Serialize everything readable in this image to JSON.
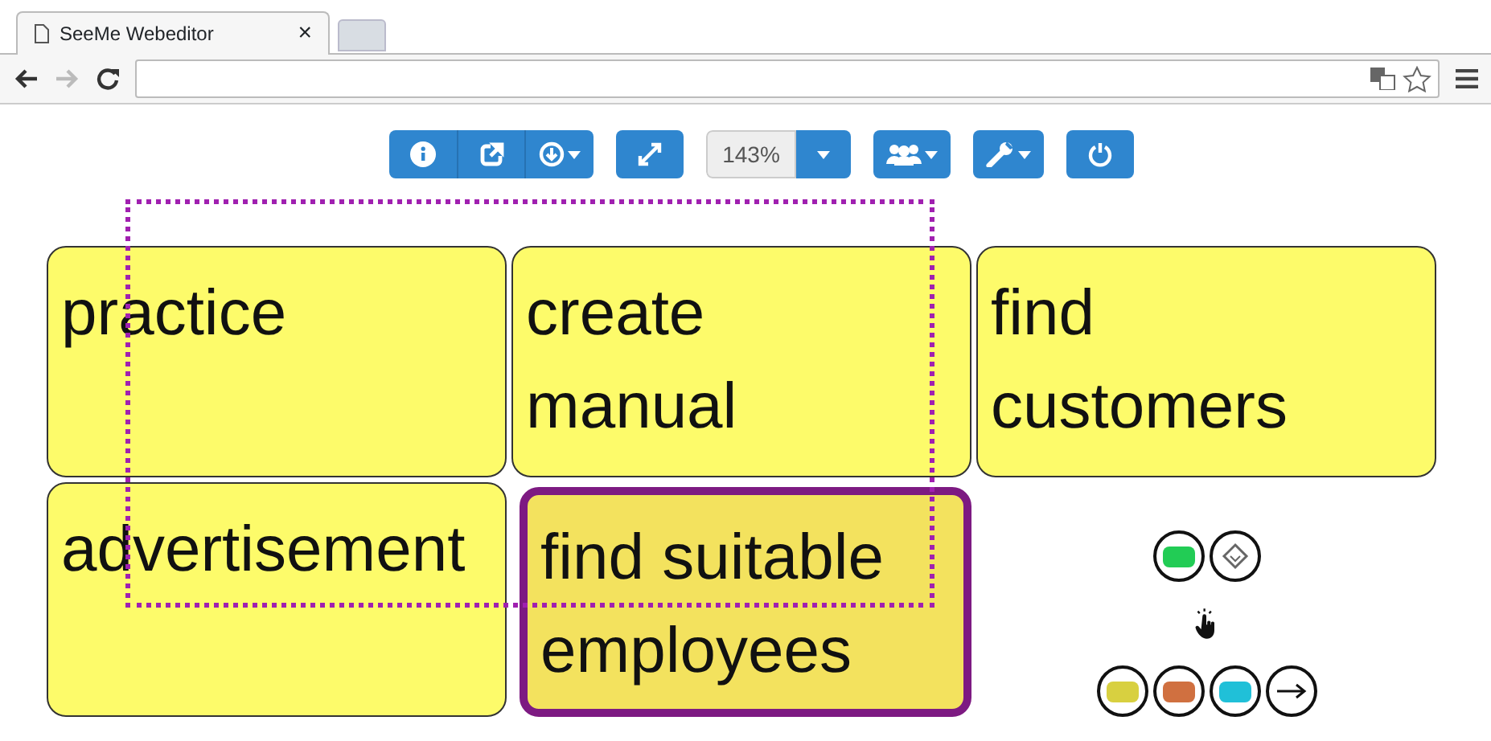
{
  "browser": {
    "tab_title": "SeeMe Webeditor",
    "tab_close": "×"
  },
  "toolbar": {
    "zoom": "143%"
  },
  "cards": [
    {
      "text": "practice",
      "selected": false
    },
    {
      "text": "create manual",
      "selected": false
    },
    {
      "text": "find customers",
      "selected": false
    },
    {
      "text": "advertisement",
      "selected": false
    },
    {
      "text": "find suitable employees",
      "selected": true
    }
  ],
  "palette": {
    "top": [
      {
        "kind": "shape",
        "color": "#22cc55"
      },
      {
        "kind": "stamp"
      }
    ],
    "bottom": [
      {
        "kind": "shape",
        "color": "#d8d040"
      },
      {
        "kind": "shape",
        "color": "#d07040"
      },
      {
        "kind": "shape",
        "color": "#20c0d8"
      },
      {
        "kind": "arrow"
      }
    ]
  },
  "selection_frame": true
}
